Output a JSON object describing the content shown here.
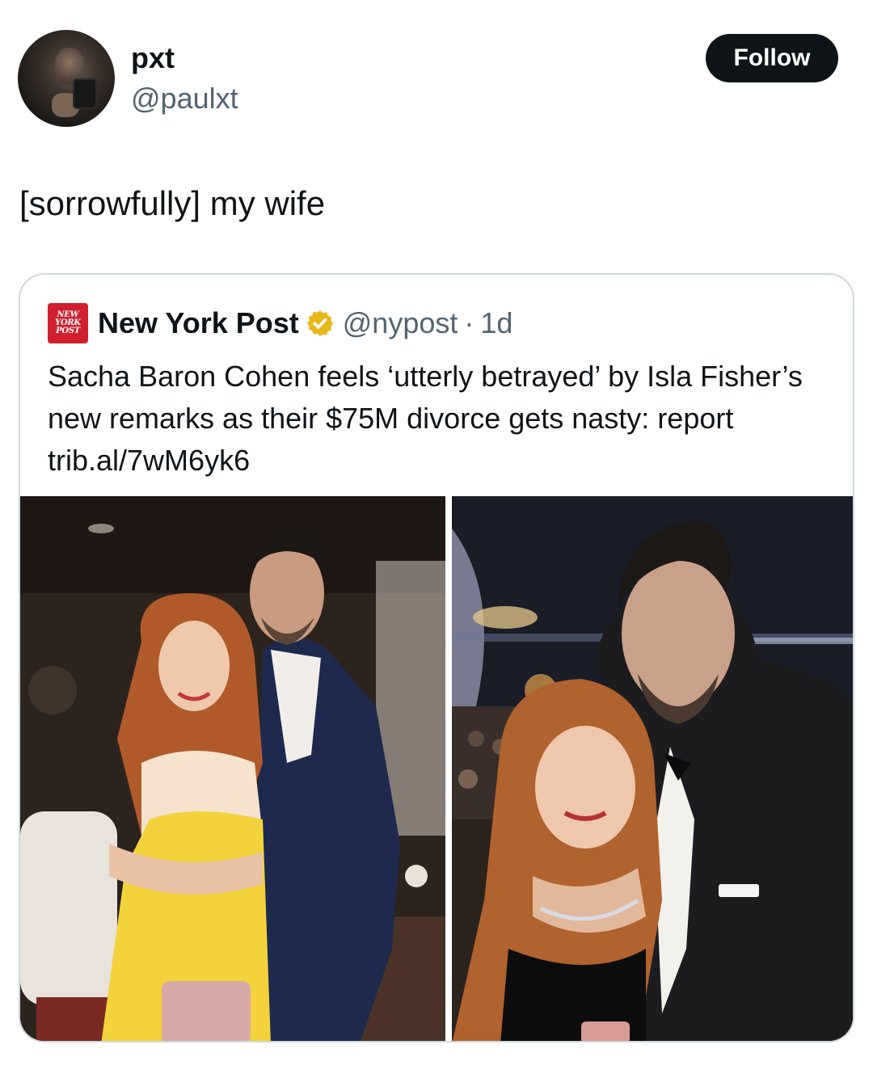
{
  "post": {
    "display_name": "pxt",
    "handle": "@paulxt",
    "follow_label": "Follow",
    "text": "[sorrowfully] my wife"
  },
  "quoted": {
    "logo_lines": [
      "NEW",
      "YORK",
      "POST"
    ],
    "name": "New York Post",
    "handle": "@nypost",
    "dot": "·",
    "time": "1d",
    "text": "Sacha Baron Cohen feels ‘utterly betrayed’ by Isla Fisher’s new remarks as their $75M divorce gets nasty: report trib.al/7wM6yk6",
    "verified_color": "#e8b71a",
    "brand_color": "#d0202e"
  },
  "icons": {
    "verified": "verified-badge-icon"
  }
}
